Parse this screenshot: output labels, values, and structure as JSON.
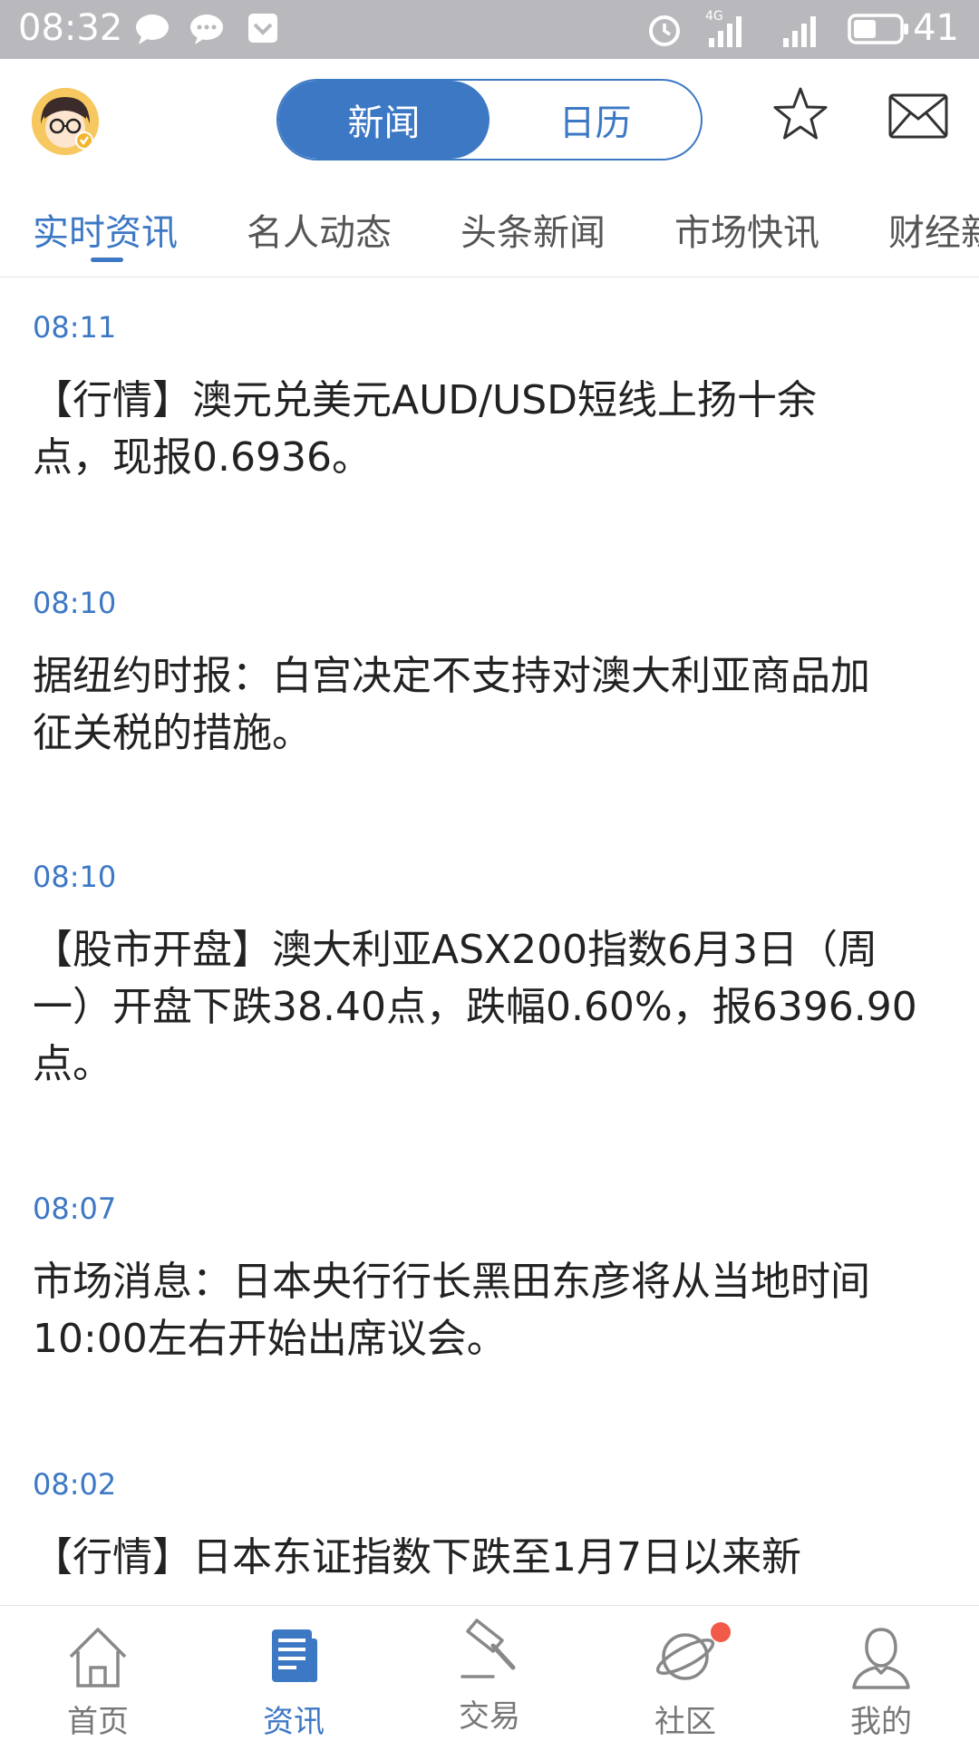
{
  "status_bar": {
    "time": "08:32",
    "network": "4G",
    "battery": "41",
    "icons": [
      "chat-bubble-icon",
      "message-icon",
      "app-icon",
      "alarm-icon",
      "signal-icon",
      "signal-icon",
      "battery-icon"
    ]
  },
  "header": {
    "segments": [
      {
        "label": "新闻",
        "active": true
      },
      {
        "label": "日历",
        "active": false
      }
    ],
    "icons": [
      "avatar",
      "star-icon",
      "mail-icon"
    ]
  },
  "tabs": [
    {
      "label": "实时资讯",
      "active": true
    },
    {
      "label": "名人动态",
      "active": false
    },
    {
      "label": "头条新闻",
      "active": false
    },
    {
      "label": "市场快讯",
      "active": false
    },
    {
      "label": "财经新",
      "active": false
    }
  ],
  "feed": [
    {
      "time": "08:11",
      "lines": [
        "【行情】澳元兑美元AUD/USD短线上扬十余",
        "点，现报0.6936。"
      ]
    },
    {
      "time": "08:10",
      "lines": [
        "据纽约时报：白宫决定不支持对澳大利亚商品加",
        "征关税的措施。"
      ]
    },
    {
      "time": "08:10",
      "lines": [
        "【股市开盘】澳大利亚ASX200指数6月3日（周",
        "一）开盘下跌38.40点，跌幅0.60%，报6396.90",
        "点。"
      ]
    },
    {
      "time": "08:07",
      "lines": [
        "市场消息：日本央行行长黑田东彦将从当地时间",
        "10:00左右开始出席议会。"
      ]
    },
    {
      "time": "08:02",
      "lines": [
        "【行情】日本东证指数下跌至1月7日以来新"
      ]
    }
  ],
  "bottom_nav": [
    {
      "label": "首页",
      "icon": "home-icon",
      "active": false
    },
    {
      "label": "资讯",
      "icon": "news-icon",
      "active": true
    },
    {
      "label": "交易",
      "icon": "gavel-icon",
      "active": false
    },
    {
      "label": "社区",
      "icon": "planet-icon",
      "active": false,
      "badge": true
    },
    {
      "label": "我的",
      "icon": "user-icon",
      "active": false
    }
  ],
  "colors": {
    "accent": "#3d78c5",
    "status_bar": "#b9b9bd",
    "badge": "#f05a47"
  }
}
